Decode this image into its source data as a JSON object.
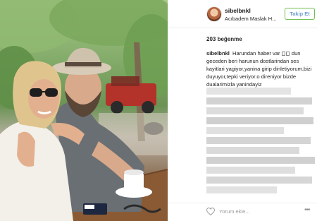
{
  "post": {
    "photo_alt": "photo"
  },
  "header": {
    "username": "sibelbnkl",
    "location": "Acıbadem Maslak H...",
    "follow_label": "Takip Et"
  },
  "likes": "203 beğenme",
  "caption": {
    "username": "sibelbnkl",
    "text_part1": "Harundan haber var",
    "text_part2": "dun geceden beri harunun dostlarindan ses kayitlari yagiyor,yanina girip dinletiyorum,bizi duyuyor,tepki veriyor.o direniyor bizde dualarimizla yanindayiz"
  },
  "comment_box": {
    "placeholder": "Yorum ekle..."
  },
  "icons": {
    "like": "heart-icon",
    "more": "more-icon",
    "avatar": "avatar"
  },
  "colors": {
    "follow_text": "#70a0cf",
    "follow_border": "#70c050",
    "border": "#efefef"
  }
}
